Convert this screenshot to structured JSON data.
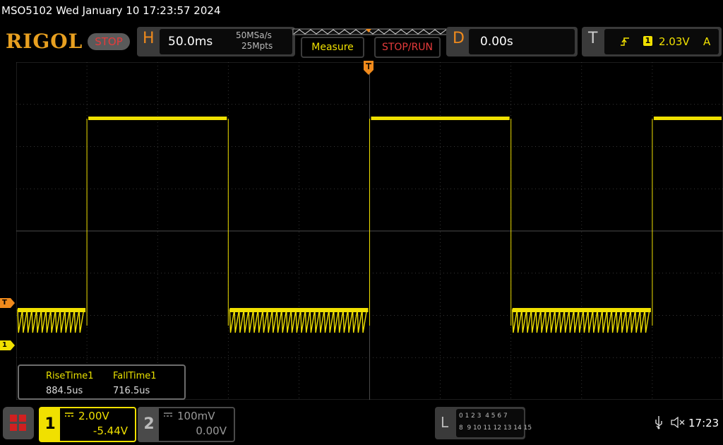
{
  "titlebar": {
    "text": "MSO5102  Wed January 10 17:23:57 2024"
  },
  "header": {
    "logo": "RIGOL",
    "run_state": "STOP",
    "horizontal": {
      "letter": "H",
      "timebase": "50.0ms",
      "sample_rate": "50MSa/s",
      "memory_depth": "25Mpts"
    },
    "measure_label": "Measure",
    "stop_run_label": "STOP/RUN",
    "delay": {
      "letter": "D",
      "value": "0.00s"
    },
    "trigger": {
      "letter": "T",
      "level": "2.03V",
      "mode": "A",
      "source": "1"
    }
  },
  "markers": {
    "trigger_level": "T",
    "ch1_ground": "1"
  },
  "measurements": {
    "items": [
      {
        "label": "RiseTime1",
        "value": "884.5us"
      },
      {
        "label": "FallTime1",
        "value": "716.5us"
      }
    ]
  },
  "channels": [
    {
      "number": "1",
      "scale": "2.00V",
      "offset": "-5.44V",
      "color": "#f0e000"
    },
    {
      "number": "2",
      "scale": "100mV",
      "offset": "0.00V",
      "color": "#888888"
    }
  ],
  "digital": {
    "letter": "L",
    "row1": "0 1 2 3  4 5 6 7",
    "row2": "8  9 10 11 12 13 14 15"
  },
  "status": {
    "time": "17:23"
  },
  "colors": {
    "trace": "#f0e000",
    "accent": "#f08a1c",
    "grid": "#4a4a4a"
  },
  "waveform": {
    "description_free": true,
    "high_segments": [
      {
        "start_div": 1.0,
        "end_div": 3.0
      },
      {
        "start_div": 5.0,
        "end_div": 7.0
      },
      {
        "start_div": 9.0,
        "end_div": 10.0
      }
    ],
    "low_segments": [
      {
        "start_div": 0.0,
        "end_div": 1.0
      },
      {
        "start_div": 3.0,
        "end_div": 5.0
      },
      {
        "start_div": 7.0,
        "end_div": 9.0
      }
    ]
  }
}
